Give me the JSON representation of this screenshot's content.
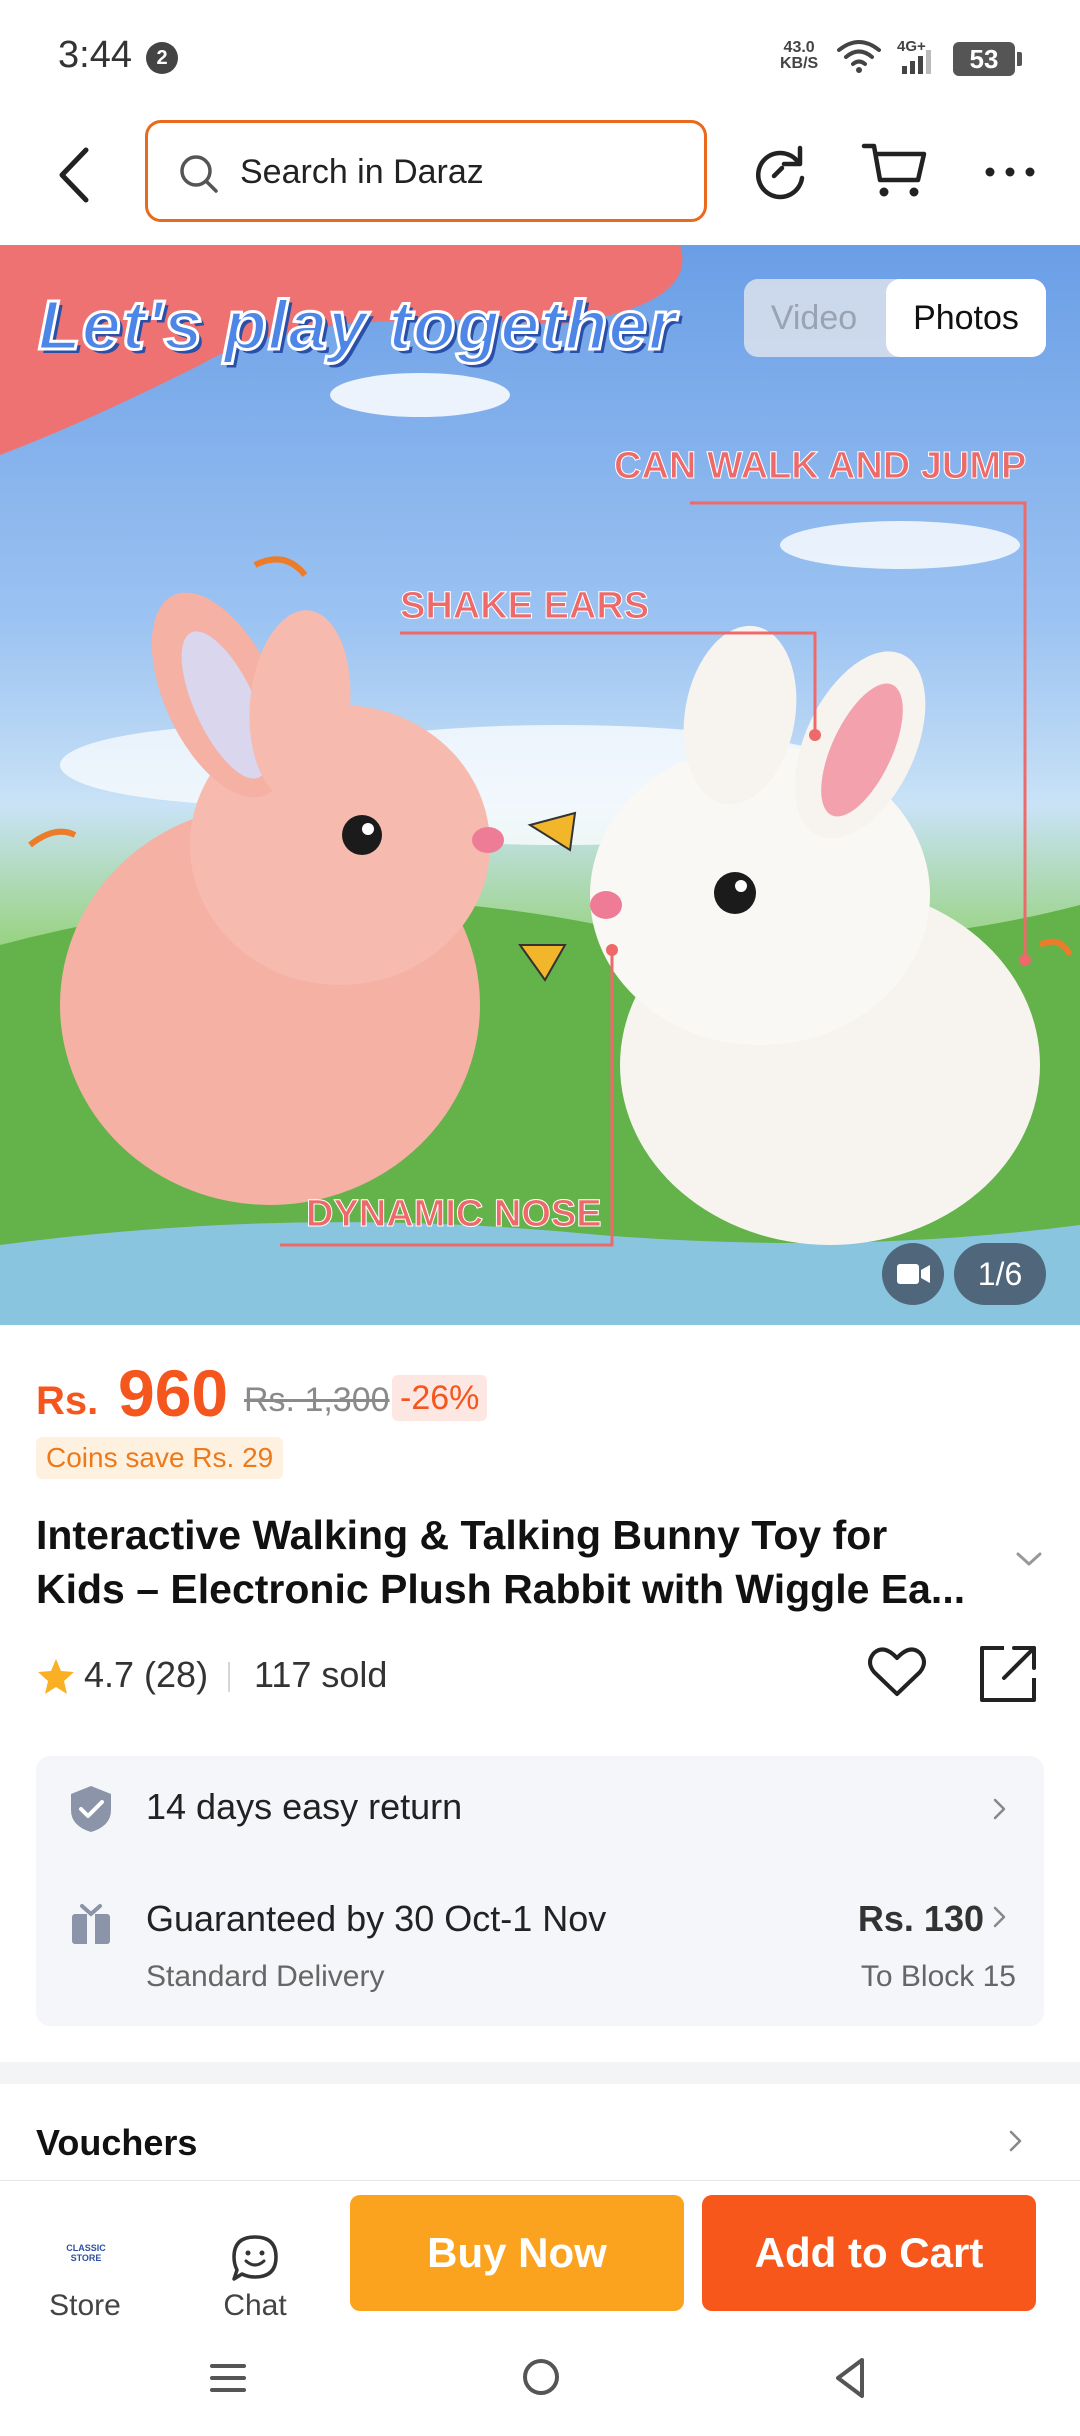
{
  "status_bar": {
    "time": "3:44",
    "notification_count": "2",
    "net_speed_value": "43.0",
    "net_speed_unit": "KB/S",
    "network_type": "4G+",
    "battery": "53"
  },
  "header": {
    "search_placeholder": "Search in Daraz",
    "icons": [
      "back-arrow",
      "search",
      "history-refresh",
      "cart",
      "more"
    ]
  },
  "hero": {
    "headline": "Let's play together",
    "callout_walk": "CAN WALK AND JUMP",
    "callout_ears": "SHAKE EARS",
    "callout_nose": "DYNAMIC NOSE",
    "toggle_video": "Video",
    "toggle_photos": "Photos",
    "page_counter": "1/6"
  },
  "product": {
    "price_currency": "Rs.",
    "price": "960",
    "original_price": "Rs. 1,300",
    "discount": "-26%",
    "coins_note": "Coins save Rs. 29",
    "title_line1": "Interactive Walking & Talking Bunny Toy for",
    "title_line2": "Kids – Electronic Plush Rabbit with Wiggle Ea...",
    "rating": "4.7 (28)",
    "sold": "117 sold"
  },
  "services": {
    "return_policy": "14 days easy return",
    "delivery_title": "Guaranteed by 30 Oct-1 Nov",
    "delivery_type": "Standard Delivery",
    "delivery_fee": "Rs. 130",
    "delivery_location": "To Block 15"
  },
  "vouchers": {
    "label": "Vouchers"
  },
  "action_bar": {
    "store_logo_text": "CLASSIC STORE",
    "store_label": "Store",
    "chat_label": "Chat",
    "buy_now": "Buy Now",
    "add_to_cart": "Add to Cart"
  },
  "colors": {
    "accent_orange": "#f4561d",
    "buy_now": "#fba31e",
    "add_to_cart": "#f8571b",
    "search_border": "#e96a1c"
  }
}
